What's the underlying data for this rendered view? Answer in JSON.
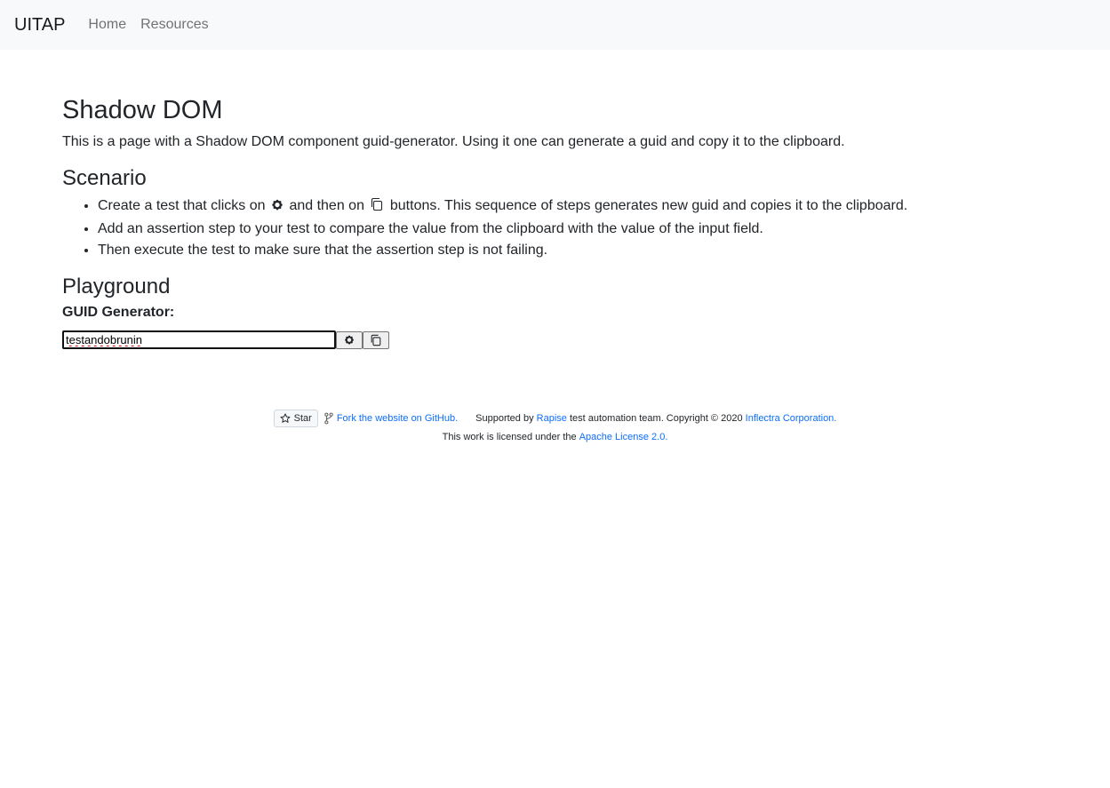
{
  "nav": {
    "brand": "UITAP",
    "links": [
      "Home",
      "Resources"
    ]
  },
  "page": {
    "title": "Shadow DOM",
    "intro": "This is a page with a Shadow DOM component guid-generator. Using it one can generate a guid and copy it to the clipboard."
  },
  "scenario": {
    "heading": "Scenario",
    "step1_before": "Create a test that clicks on",
    "step1_middle": "and then on",
    "step1_after": "buttons. This sequence of steps generates new guid and copies it to the clipboard.",
    "step2": "Add an assertion step to your test to compare the value from the clipboard with the value of the input field.",
    "step3": "Then execute the test to make sure that the assertion step is not failing."
  },
  "playground": {
    "heading": "Playground",
    "label": "GUID Generator:",
    "input_value": "testandobrunin",
    "generate_icon": "gear-icon",
    "copy_icon": "copy-icon"
  },
  "footer": {
    "star_label": "Star",
    "fork_link": "Fork the website on GitHub.",
    "supported_by": "Supported by",
    "rapise_link": "Rapise",
    "team_text": "test automation team. Copyright © 2020",
    "inflectra_link": "Inflectra Corporation.",
    "license_text": "This work is licensed under the",
    "license_link": "Apache License 2.0."
  },
  "colors": {
    "navbar_bg": "#f8f9fa",
    "link": "#0d6efd",
    "text": "#212529"
  }
}
